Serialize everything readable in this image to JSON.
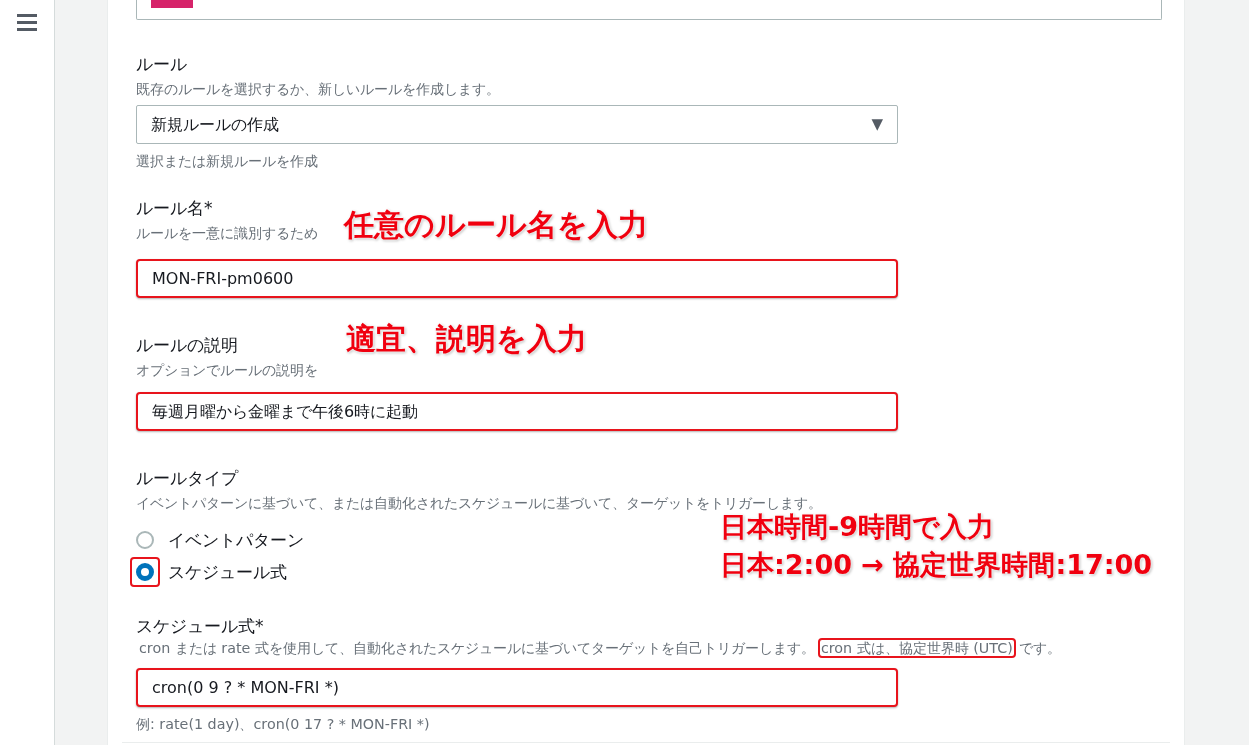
{
  "rule": {
    "label": "ルール",
    "hint": "既存のルールを選択するか、新しいルールを作成します。",
    "select": {
      "value": "新規ルールの作成",
      "arrow": "▼"
    },
    "help": "選択または新規ルールを作成"
  },
  "rule_name": {
    "label": "ルール名*",
    "hint": "ルールを一意に識別するため",
    "value": "MON-FRI-pm0600",
    "highlighted": true
  },
  "rule_description": {
    "label": "ルールの説明",
    "hint": "オプションでルールの説明を",
    "value": "毎週月曜から金曜まで午後6時に起動",
    "highlighted": true
  },
  "rule_type": {
    "label": "ルールタイプ",
    "hint": "イベントパターンに基づいて、または自動化されたスケジュールに基づいて、ターゲットをトリガーします。",
    "options": [
      {
        "label": "イベントパターン",
        "selected": false,
        "highlighted": false
      },
      {
        "label": "スケジュール式",
        "selected": true,
        "highlighted": true
      }
    ]
  },
  "schedule": {
    "label": "スケジュール式*",
    "hint_parts": [
      {
        "text": "cron または rate 式を使用して、自動化されたスケジュールに基づいてターゲットを自己トリガーします。",
        "highlighted": false
      },
      {
        "text": "cron 式は、協定世界時 (UTC)",
        "highlighted": true
      },
      {
        "text": "です。",
        "highlighted": false
      }
    ],
    "value": "cron(0 9 ? * MON-FRI *)",
    "highlighted": true,
    "example": "例: rate(1 day)、cron(0 17 ? * MON-FRI *)"
  },
  "callouts": [
    "任意のルール名を入力",
    "適宜、説明を入力",
    "日本時間-9時間で入力",
    "日本:2:00 → 協定世界時間:17:00"
  ]
}
